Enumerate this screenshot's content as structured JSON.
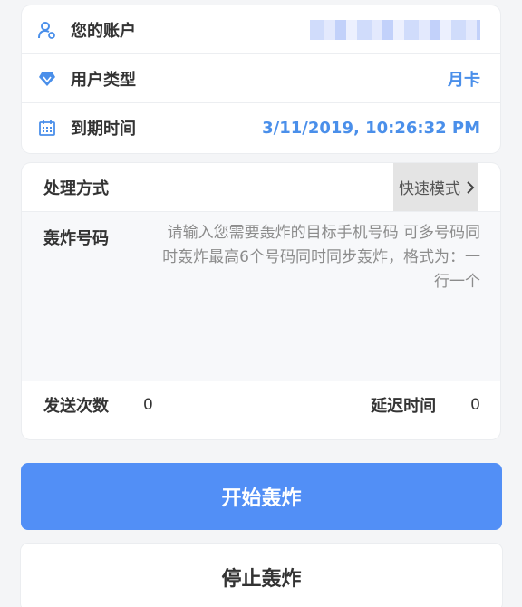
{
  "account": {
    "username": {
      "label": "您的账户",
      "icon": "user-icon"
    },
    "user_type": {
      "label": "用户类型",
      "value": "月卡",
      "icon": "diamond-icon"
    },
    "expiry": {
      "label": "到期时间",
      "value": "3/11/2019, 10:26:32 PM",
      "icon": "calendar-icon"
    }
  },
  "form": {
    "mode": {
      "label": "处理方式",
      "value": "快速模式",
      "icon": "chevron-right-icon"
    },
    "numbers": {
      "label": "轰炸号码",
      "value": "",
      "placeholder": "请输入您需要轰炸的目标手机号码 可多号码同时轰炸最高6个号码同时同步轰炸，格式为：一行一个"
    },
    "send_count": {
      "label": "发送次数",
      "value": "0"
    },
    "delay": {
      "label": "延迟时间",
      "value": "0"
    }
  },
  "actions": {
    "start_label": "开始轰炸",
    "stop_label": "停止轰炸"
  },
  "colors": {
    "accent": "#528ff6",
    "value_text": "#4a8fea",
    "page_bg": "#f4f5f7"
  }
}
